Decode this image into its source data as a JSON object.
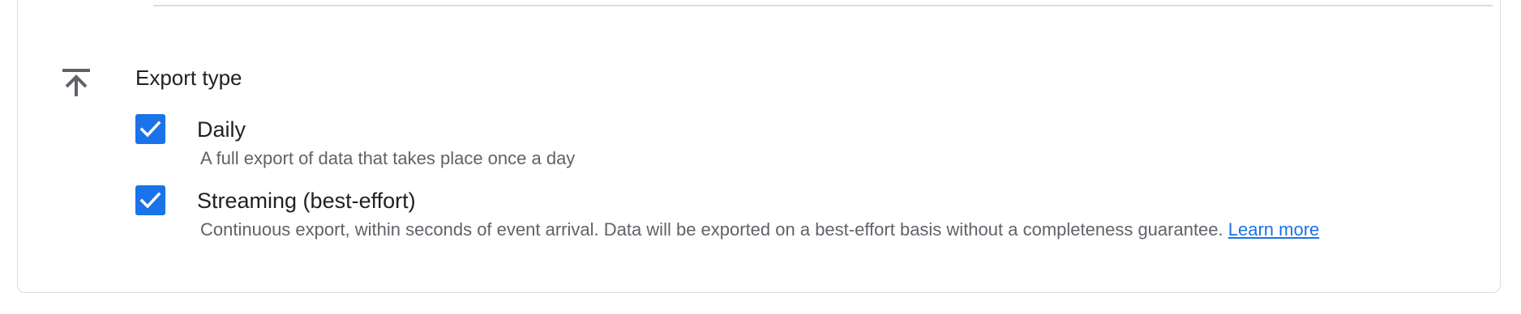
{
  "section": {
    "icon": "upload-icon",
    "title": "Export type"
  },
  "options": [
    {
      "label": "Daily",
      "description": "A full export of data that takes place once a day",
      "checked": true
    },
    {
      "label": "Streaming (best-effort)",
      "description": "Continuous export, within seconds of event arrival. Data will be exported on a best-effort basis without a completeness guarantee.",
      "link_text": "Learn more",
      "checked": true
    }
  ],
  "colors": {
    "accent": "#1a73e8",
    "border": "#dadce0",
    "text_primary": "#202124",
    "text_secondary": "#5f6368",
    "icon": "#5f6368"
  }
}
